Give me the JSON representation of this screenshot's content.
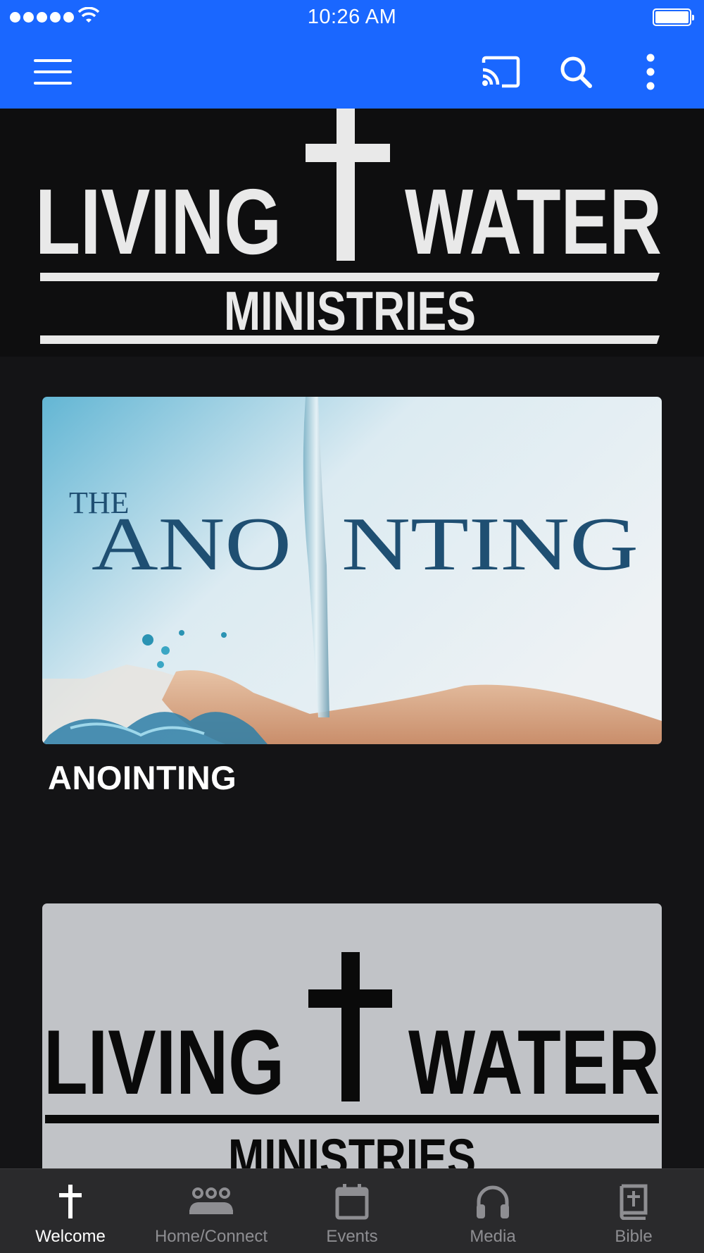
{
  "status_bar": {
    "time": "10:26 AM"
  },
  "header": {
    "logo_line1_left": "LIVING",
    "logo_line1_right": "WATER",
    "logo_line2": "MINISTRIES"
  },
  "cards": [
    {
      "image_text_small": "THE",
      "image_text_large_a": "ANO",
      "image_text_large_b": "NTING",
      "title": "ANOINTING"
    },
    {
      "logo_line1_left": "LIVING",
      "logo_line1_right": "WATER",
      "logo_line2": "MINISTRIES"
    }
  ],
  "tabs": [
    {
      "label": "Welcome",
      "icon": "cross-icon",
      "active": true
    },
    {
      "label": "Home/Connect",
      "icon": "group-icon",
      "active": false
    },
    {
      "label": "Events",
      "icon": "calendar-icon",
      "active": false
    },
    {
      "label": "Media",
      "icon": "headphones-icon",
      "active": false
    },
    {
      "label": "Bible",
      "icon": "bible-icon",
      "active": false
    }
  ],
  "colors": {
    "accent": "#1a67ff",
    "background": "#141416",
    "tab_bar": "#2a2a2c",
    "tab_inactive": "#8e8e92",
    "tab_active": "#ffffff"
  }
}
